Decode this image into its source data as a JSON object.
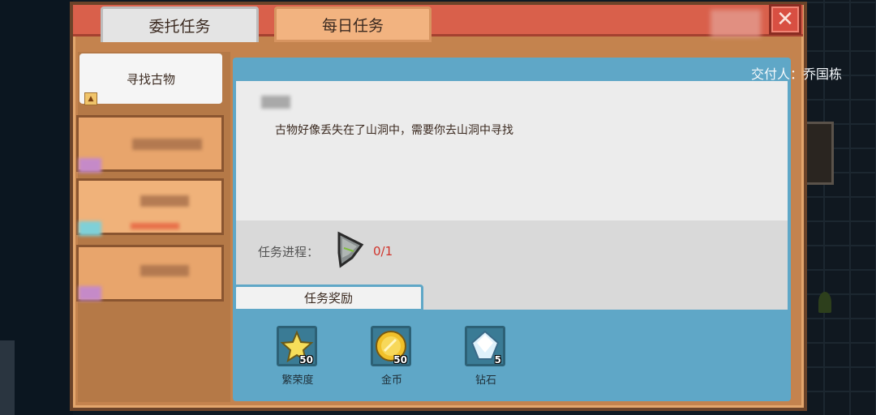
{
  "tabs": {
    "commission_label": "委托任务",
    "daily_label": "每日任务"
  },
  "close_symbol": "✕",
  "quest_list": {
    "selected_label": "寻找古物"
  },
  "quest_detail": {
    "giver": "交付人：乔国栋",
    "description": "古物好像丢失在了山洞中，需要你去山洞中寻找",
    "progress_label": "任务进程：",
    "progress_value": "0/1",
    "rewards_tab_label": "任务奖励"
  },
  "rewards": [
    {
      "name": "繁荣度",
      "count": "50",
      "icon": "star-icon"
    },
    {
      "name": "金币",
      "count": "50",
      "icon": "gold-coin-icon"
    },
    {
      "name": "钻石",
      "count": "5",
      "icon": "diamond-icon"
    }
  ],
  "colors": {
    "panel": "#c4834e",
    "header_red": "#d9604b",
    "detail_blue": "#5fa7c7",
    "progress_red": "#d0342c"
  }
}
